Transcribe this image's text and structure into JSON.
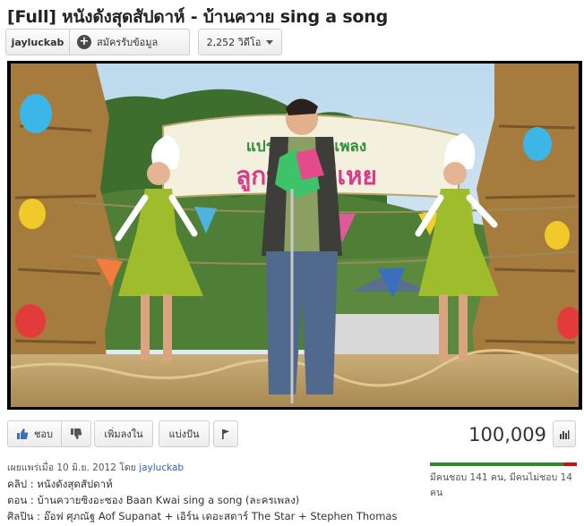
{
  "video": {
    "title": "[Full] หนังดังสุดสัปดาห์ - บ้านควาย sing a song",
    "views": "100,009"
  },
  "channel": {
    "name": "jayluckab",
    "subscribe_label": "สมัครรับข้อมูล",
    "video_count": "2,252 วิดีโอ"
  },
  "actions": {
    "like_label": "ชอบ",
    "add_to_label": "เพิ่มลงใน",
    "share_label": "แบ่งปัน"
  },
  "published": {
    "prefix": "เผยแพร่เมื่อ 10 มิ.ย. 2012 โดย",
    "author": "jayluckab"
  },
  "ratings": {
    "likes": 141,
    "dislikes": 14,
    "like_fraction": 0.91,
    "summary": "มีคนชอบ 141 คน, มีคนไม่ชอบ 14 คน",
    "like_color": "#2d8a2d",
    "dislike_color": "#cc1111"
  },
  "description": [
    "คลิป : หนังดังสุดสัปดาห์",
    "ตอน : บ้านควายซิงอะซอง Baan Kwai sing a song (ละครเพลง)",
    "ศิลปิน : อ๊อฟ ศุภณัฐ Aof Supanat + เอิร์น เดอะสตาร์ The Star + Stephen Thomas"
  ],
  "banner": {
    "line1": "แประกวดร้องเพลง",
    "line2": "ลูกบ้าน อีเหย"
  },
  "icons": {
    "like": "thumbs-up-icon",
    "dislike": "thumbs-down-icon",
    "flag": "flag-icon",
    "stats": "stats-icon",
    "subscribe": "plus-icon",
    "dropdown": "chevron-down-icon"
  }
}
